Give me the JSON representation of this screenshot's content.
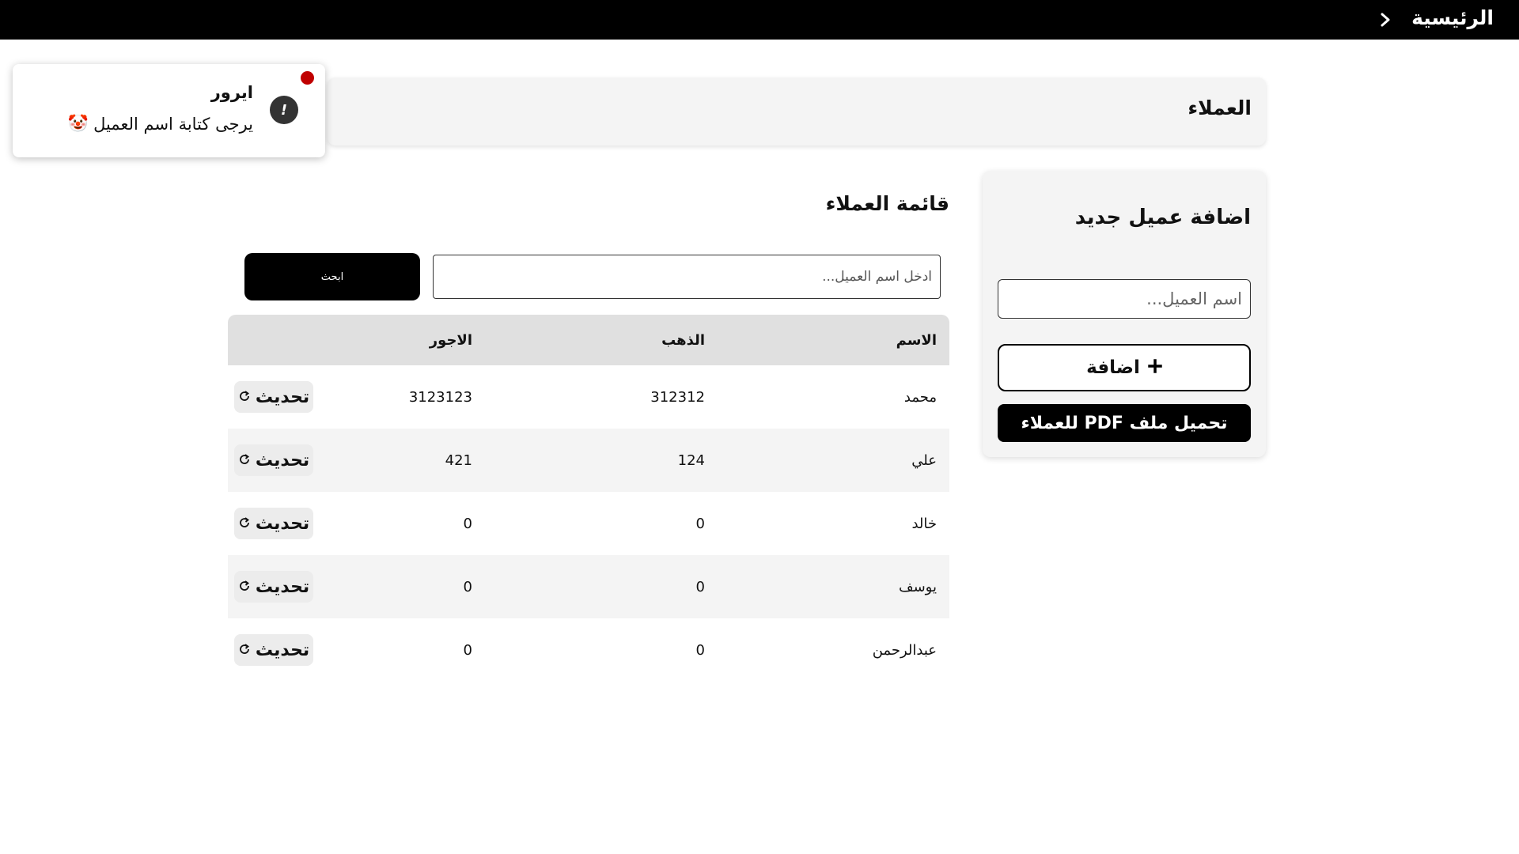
{
  "nav": {
    "home_label": "الرئيسية",
    "chevron_icon": "chevron-right-icon"
  },
  "header": {
    "title": "العملاء"
  },
  "add_customer": {
    "heading": "اضافة عميل جديد",
    "name_placeholder": "اسم العميل...",
    "add_label": "اضافة",
    "add_icon": "plus-icon",
    "pdf_label": "تحميل ملف PDF للعملاء"
  },
  "customer_list": {
    "title": "قائمة العملاء",
    "search_placeholder": "ادخل اسم العميل...",
    "search_label": "ابحث",
    "columns": {
      "name": "الاسم",
      "gold": "الذهب",
      "wages": "الاجور"
    },
    "update_label": "تحديث",
    "update_icon": "refresh-icon",
    "rows": [
      {
        "name": "محمد",
        "gold": "312312",
        "wages": "3123123"
      },
      {
        "name": "علي",
        "gold": "124",
        "wages": "421"
      },
      {
        "name": "خالد",
        "gold": "0",
        "wages": "0"
      },
      {
        "name": "يوسف",
        "gold": "0",
        "wages": "0"
      },
      {
        "name": "عبدالرحمن",
        "gold": "0",
        "wages": "0"
      }
    ]
  },
  "toast": {
    "title": "ايرور",
    "message": "يرجى كتابة اسم العميل",
    "emoji": "🤡",
    "status_color": "#c00000",
    "icon": "exclamation-icon"
  }
}
